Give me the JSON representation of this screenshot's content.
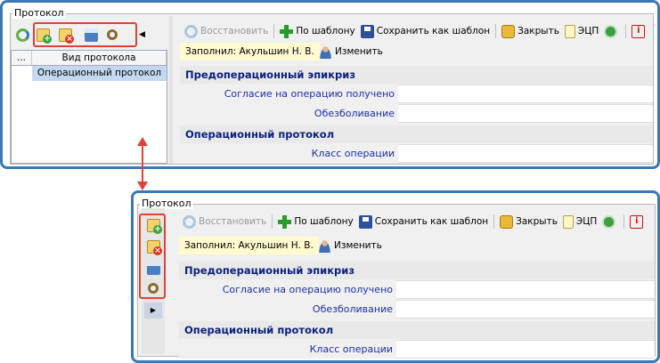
{
  "group_label": "Протокол",
  "toolbar": {
    "restore": "Восстановить",
    "by_template": "По шаблону",
    "save_as_template": "Сохранить как шаблон",
    "close": "Закрыть",
    "ecp": "ЭЦП"
  },
  "filled_by": "Заполнил:  Акульшин Н. В.",
  "edit_label": "Изменить",
  "grid": {
    "columns": [
      "...",
      "Вид протокола"
    ],
    "rows": [
      "Операционный протокол"
    ]
  },
  "sections": [
    {
      "title": "Предоперационный эпикриз",
      "fields": [
        "Согласие на операцию получено",
        "Обезболивание"
      ]
    },
    {
      "title": "Операционный протокол",
      "fields": [
        "Класс операции"
      ]
    }
  ],
  "icons": [
    "refresh-icon",
    "add-protocol-icon",
    "delete-protocol-icon",
    "print-icon",
    "preview-icon",
    "collapse-arrow-icon",
    "restore-icon",
    "plus-icon",
    "save-icon",
    "lock-icon",
    "document-icon",
    "certificate-icon",
    "info-icon",
    "user-icon"
  ],
  "colors": {
    "frame": "#3c78b4",
    "highlight": "#e0423a",
    "section_text": "#0b1f7a",
    "field_text": "#1f2ea5",
    "selected_row": "#c4d9f1",
    "filled_bg": "#fffad0"
  }
}
